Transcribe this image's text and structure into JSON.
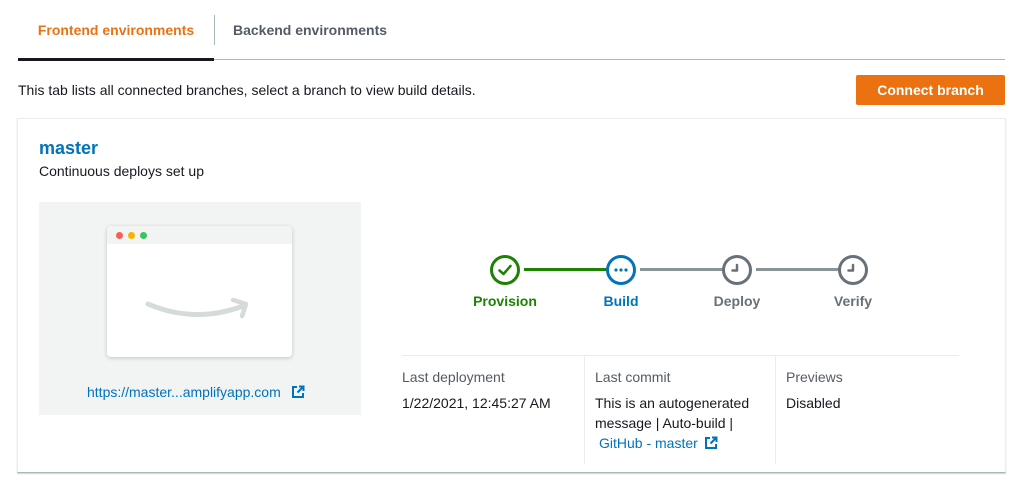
{
  "tabs": {
    "frontend": "Frontend environments",
    "backend": "Backend environments"
  },
  "description": "This tab lists all connected branches, select a branch to view build details.",
  "connect_button": "Connect branch",
  "branch": {
    "name": "master",
    "subtitle": "Continuous deploys set up",
    "app_url": "https://master...amplifyapp.com",
    "steps": [
      {
        "label": "Provision",
        "status": "complete",
        "color": "#1d8102"
      },
      {
        "label": "Build",
        "status": "in-progress",
        "color": "#0073bb"
      },
      {
        "label": "Deploy",
        "status": "pending",
        "color": "#687078"
      },
      {
        "label": "Verify",
        "status": "pending",
        "color": "#687078"
      }
    ],
    "details": {
      "last_deployment_label": "Last deployment",
      "last_deployment_value": "1/22/2021, 12:45:27 AM",
      "last_commit_label": "Last commit",
      "last_commit_text": "This is an autogenerated message | Auto-build |",
      "last_commit_link": "GitHub - master",
      "previews_label": "Previews",
      "previews_value": "Disabled"
    }
  },
  "colors": {
    "accent": "#ec7211",
    "link": "#0073bb",
    "success": "#1d8102",
    "pending": "#687078"
  }
}
